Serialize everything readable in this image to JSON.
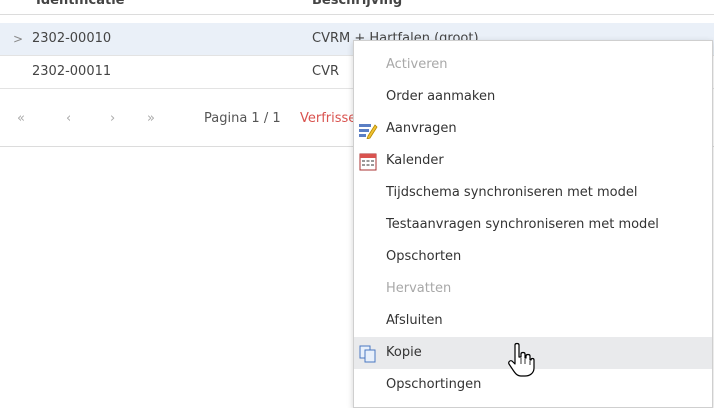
{
  "grid": {
    "columns": [
      "Identificatie",
      "Beschrijving"
    ],
    "rows": [
      {
        "expander": ">",
        "id": "2302-00010",
        "desc": "CVRM + Hartfalen (groot)"
      },
      {
        "expander": "",
        "id": "2302-00011",
        "desc": "CVR"
      }
    ]
  },
  "pager": {
    "first": "«",
    "prev": "‹",
    "next": "›",
    "last": "»",
    "page_text": "Pagina 1 / 1",
    "refresh": "Verfrissen"
  },
  "menu": {
    "items": [
      {
        "label": "Activeren",
        "disabled": true,
        "icon": ""
      },
      {
        "label": "Order aanmaken",
        "disabled": false,
        "icon": ""
      },
      {
        "label": "Aanvragen",
        "disabled": false,
        "icon": "pencil-note-icon"
      },
      {
        "label": "Kalender",
        "disabled": false,
        "icon": "calendar-icon"
      },
      {
        "label": "Tijdschema synchroniseren met model",
        "disabled": false,
        "icon": ""
      },
      {
        "label": "Testaanvragen synchroniseren met model",
        "disabled": false,
        "icon": ""
      },
      {
        "label": "Opschorten",
        "disabled": false,
        "icon": ""
      },
      {
        "label": "Hervatten",
        "disabled": true,
        "icon": ""
      },
      {
        "label": "Afsluiten",
        "disabled": false,
        "icon": ""
      },
      {
        "label": "Kopie",
        "disabled": false,
        "icon": "copy-icon",
        "hovered": true
      },
      {
        "label": "Opschortingen",
        "disabled": false,
        "icon": ""
      }
    ]
  },
  "colors": {
    "selected_row": "#eaf0f8",
    "menu_hover": "#e9eaec",
    "link_red": "#d9534f",
    "disabled_text": "#a8a8a8"
  }
}
